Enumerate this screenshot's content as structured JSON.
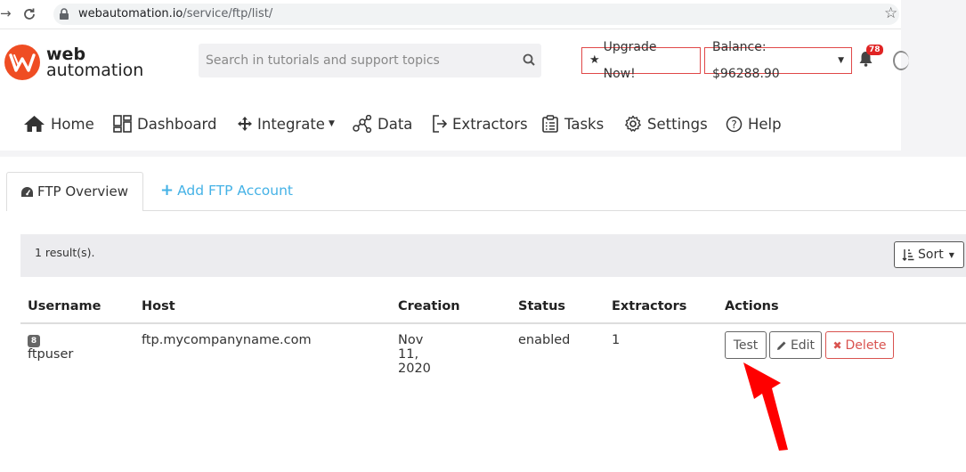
{
  "browser": {
    "url_domain": "webautomation.io",
    "url_path": "/service/ftp/list/"
  },
  "brand": {
    "line1": "web",
    "line2": "automation",
    "color": "#ef4d23"
  },
  "search": {
    "placeholder": "Search in tutorials and support topics"
  },
  "header": {
    "upgrade_label": "Upgrade Now!",
    "balance_label": "Balance: $96288.90",
    "notification_count": "78"
  },
  "nav": {
    "home": "Home",
    "dashboard": "Dashboard",
    "integrate": "Integrate",
    "data": "Data",
    "extractors": "Extractors",
    "tasks": "Tasks",
    "settings": "Settings",
    "help": "Help"
  },
  "tabs": {
    "overview": "FTP Overview",
    "add": "Add FTP Account"
  },
  "results": {
    "count_text": "1 result(s).",
    "sort_label": "Sort"
  },
  "table": {
    "headers": {
      "username": "Username",
      "host": "Host",
      "creation": "Creation",
      "status": "Status",
      "extractors": "Extractors",
      "actions": "Actions"
    },
    "rows": [
      {
        "id": "8",
        "username": "ftpuser",
        "host": "ftp.mycompanyname.com",
        "creation": "Nov 11, 2020",
        "status": "enabled",
        "extractors": "1",
        "test_label": "Test",
        "edit_label": "Edit",
        "delete_label": "Delete"
      }
    ]
  },
  "colors": {
    "accent_red": "#e04848",
    "link_blue": "#45b2e6",
    "annotation_arrow": "#ff0000"
  }
}
